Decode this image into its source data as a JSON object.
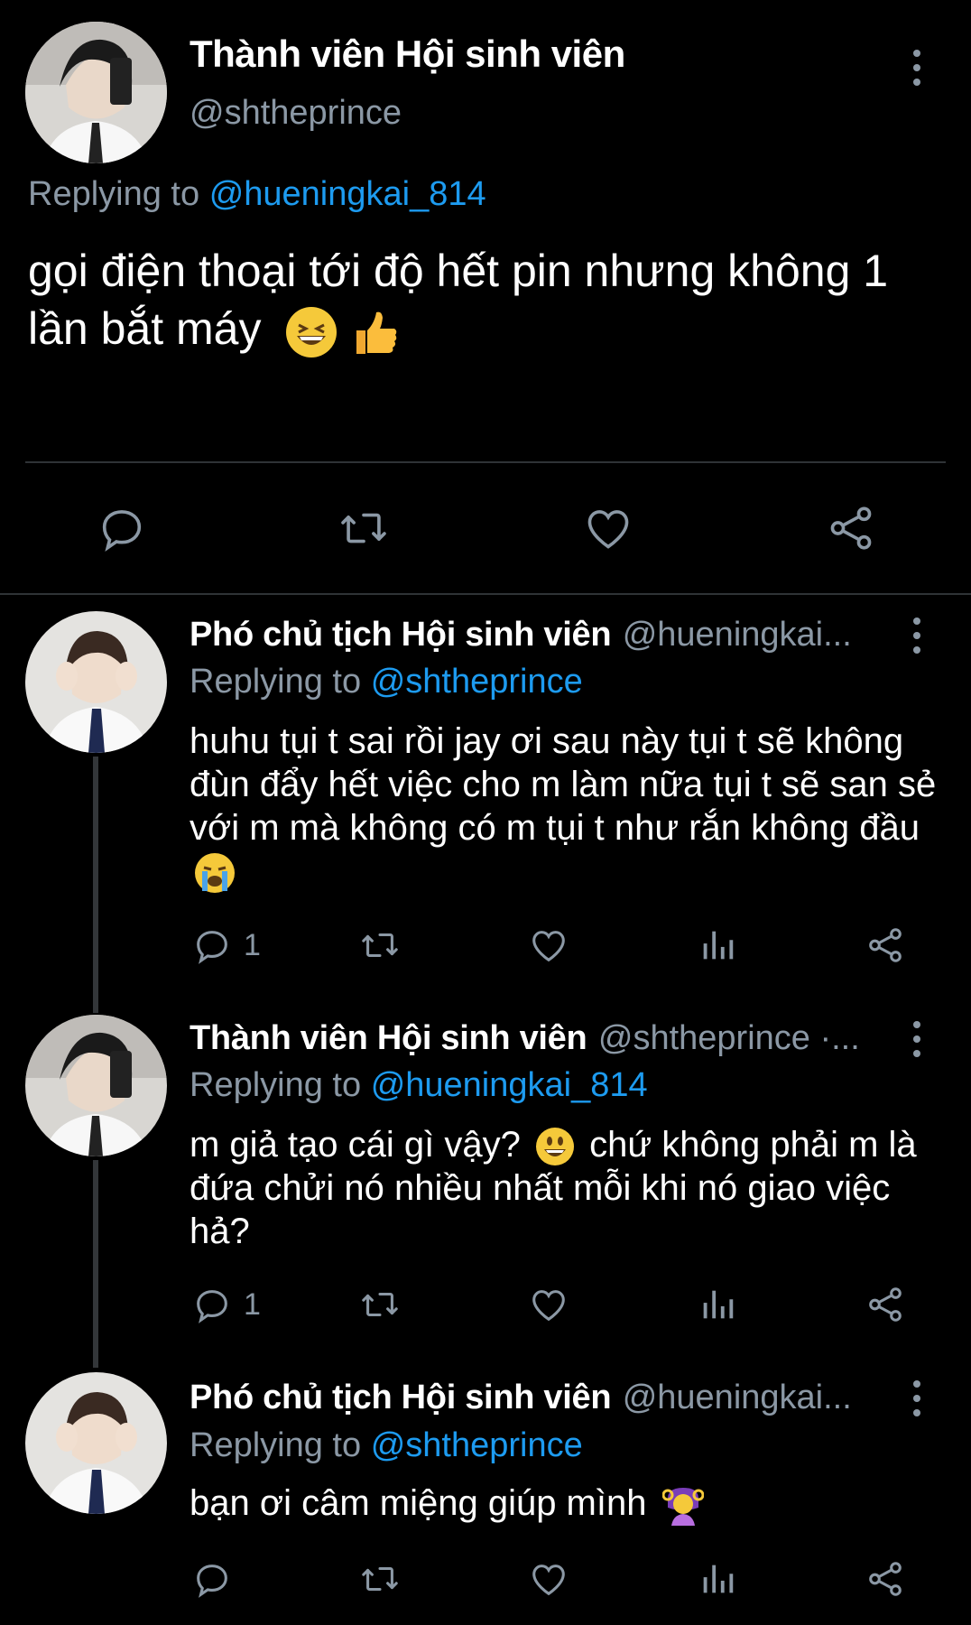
{
  "main_tweet": {
    "name": "Thành viên Hội sinh viên",
    "handle": "@shtheprince",
    "replying_label": "Replying to",
    "replying_to": "@hueningkai_814",
    "text": "gọi điện thoại tới độ hết pin nhưng không 1 lần bắt máy"
  },
  "replies": [
    {
      "name": "Phó chủ tịch Hội sinh viên",
      "handle": "@hueningkai...",
      "replying_label": "Replying to",
      "replying_to": "@shtheprince",
      "text": "huhu tụi t sai rồi jay ơi sau này tụi t sẽ không đùn đẩy hết việc cho m làm nữa tụi t sẽ san sẻ với m mà không có m tụi t như rắn không đầu",
      "reply_count": "1"
    },
    {
      "name": "Thành viên Hội sinh viên",
      "handle": "@shtheprince ·...",
      "replying_label": "Replying to",
      "replying_to": "@hueningkai_814",
      "text_a": "m giả tạo cái gì vậy?",
      "text_b": "chứ không phải m là đứa chửi nó nhiều nhất mỗi khi nó giao việc hả?",
      "reply_count": "1"
    },
    {
      "name": "Phó chủ tịch Hội sinh viên",
      "handle": "@hueningkai...",
      "replying_label": "Replying to",
      "replying_to": "@shtheprince",
      "text": "bạn ơi câm miệng giúp mình"
    }
  ],
  "colors": {
    "background": "#000000",
    "secondary_text": "#8b98a5",
    "link": "#1d9bf0",
    "divider": "#2f3336"
  },
  "icons": [
    "more-icon",
    "reply-icon",
    "retweet-icon",
    "like-icon",
    "share-icon",
    "analytics-icon"
  ]
}
